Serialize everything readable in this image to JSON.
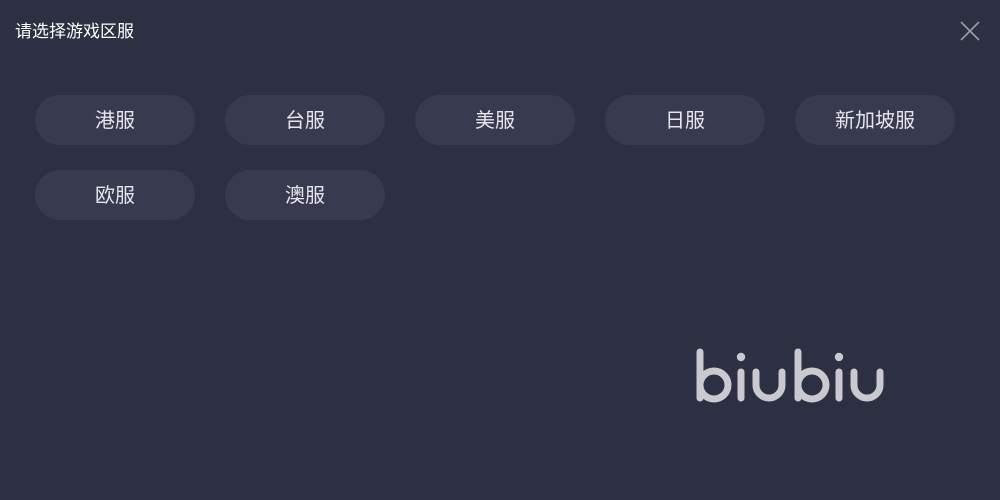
{
  "dialog": {
    "title": "请选择游戏区服",
    "close_icon": "close-icon"
  },
  "servers": [
    {
      "label": "港服"
    },
    {
      "label": "台服"
    },
    {
      "label": "美服"
    },
    {
      "label": "日服"
    },
    {
      "label": "新加坡服"
    },
    {
      "label": "欧服"
    },
    {
      "label": "澳服"
    }
  ],
  "logo": {
    "text": "biubiu",
    "color": "#c9c9cf"
  },
  "colors": {
    "background": "#2d3043",
    "button_bg": "#383b50",
    "button_text": "#e6e6ec"
  }
}
